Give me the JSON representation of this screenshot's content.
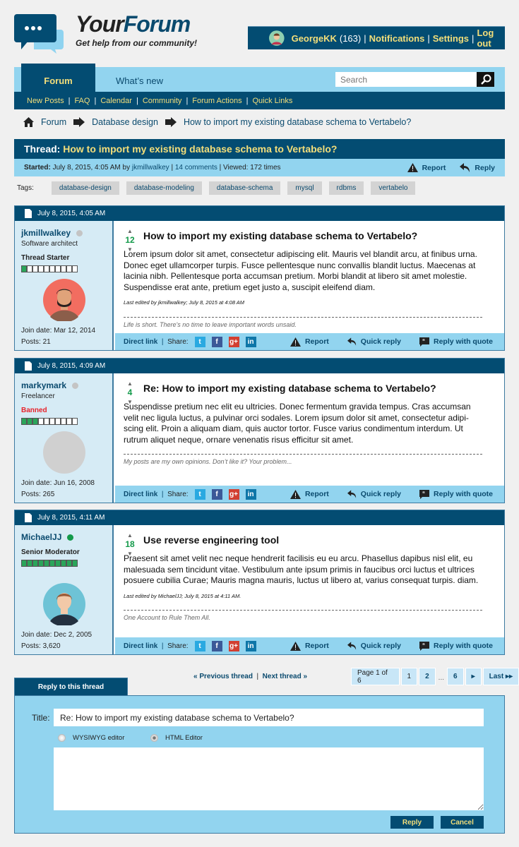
{
  "brand": {
    "name_a": "Your",
    "name_b": "Forum",
    "tagline": "Get help from our community!"
  },
  "user": {
    "name": "GeorgeKK",
    "points": "(163)",
    "notifications": "Notifications",
    "settings": "Settings",
    "logout": "Log out"
  },
  "nav": {
    "tabs": [
      "Forum",
      "What’s new"
    ],
    "search_placeholder": "Search",
    "sub": [
      "New Posts",
      "FAQ",
      "Calendar",
      "Community",
      "Forum Actions",
      "Quick Links"
    ]
  },
  "breadcrumb": [
    "Forum",
    "Database design",
    "How to import my existing database schema to Vertabelo?"
  ],
  "thread": {
    "prefix": "Thread:",
    "title": "How to import my existing database schema to Vertabelo?",
    "started_label": "Started:",
    "started": "July 8, 2015, 4:05 AM by",
    "author": "jkmillwalkey",
    "comments": "14 comments",
    "viewed": "Viewed: 172 times",
    "report": "Report",
    "reply": "Reply"
  },
  "tags_label": "Tags:",
  "tags": [
    "database-design",
    "database-modeling",
    "database-schema",
    "mysql",
    "rdbms",
    "vertabelo"
  ],
  "post_footer": {
    "direct_link": "Direct link",
    "share": "Share:",
    "report": "Report",
    "quick_reply": "Quick reply",
    "reply_quote": "Reply with quote"
  },
  "colors": {
    "dark": "#034c72",
    "light": "#92d4ef",
    "accent": "#f3de7a",
    "online": "#139a4a",
    "offline": "#c4c4c4",
    "banned": "#e8222a"
  },
  "posts": [
    {
      "date": "July 8, 2015, 4:05 AM",
      "user": "jkmillwalkey",
      "online": false,
      "role": "Software architect",
      "status": "Thread Starter",
      "status_color": "#222",
      "rank_filled": 1,
      "avatar": "bearded-man",
      "join": "Join date: Mar 12, 2014",
      "posts": "Posts: 21",
      "votes": "12",
      "title": "How to import my existing database schema to Vertabelo?",
      "text": "Lorem ipsum dolor sit amet, consectetur adipiscing elit. Mauris vel blandit arcu, at finibus urna. Donec eget ullamcorper turpis. Fusce pellentesque nunc convallis blandit luctus. Maecenas at lacinia nibh. Pellentesque porta accumsan pretium. Morbi blandit at libero sit amet molestie. Suspendisse erat ante, pretium eget justo a, suscipit eleifend diam.",
      "edited": "Last edited by jkmillwalkey; July 8, 2015 at 4:08 AM",
      "signature": "Life is short. There's no time to leave important words unsaid."
    },
    {
      "date": "July 8, 2015, 4:09 AM",
      "user": "markymark",
      "online": false,
      "role": "Freelancer",
      "status": "Banned",
      "status_color": "#e8222a",
      "rank_filled": 3,
      "avatar": "placeholder",
      "join": "Join date: Jun 16, 2008",
      "posts": "Posts: 265",
      "votes": "4",
      "title": "Re: How to import my existing database schema to Vertabelo?",
      "text": "Suspendisse pretium nec elit eu ultricies. Donec fermentum gravida tempus. Cras accumsan velit nec ligula luctus, a pulvinar orci sodales. Lorem ipsum dolor sit amet, consectetur adipi-scing elit. Proin a aliquam diam, quis auctor tortor. Fusce varius condimentum interdum. Ut rutrum aliquet neque, ornare venenatis risus efficitur sit amet.",
      "edited": "",
      "signature": "My posts are my own opinions. Don’t like it? Your problem..."
    },
    {
      "date": "July 8, 2015, 4:11 AM",
      "user": "MichaelJJ",
      "online": true,
      "role": "",
      "status": "Senior Moderator",
      "status_color": "#222",
      "rank_filled": 10,
      "avatar": "man",
      "join": "Join date: Dec 2, 2005",
      "posts": "Posts: 3,620",
      "votes": "18",
      "title": "Use reverse engineering tool",
      "text": "Praesent sit amet velit nec neque hendrerit facilisis eu eu arcu. Phasellus dapibus nisl elit, eu malesuada sem tincidunt vitae. Vestibulum ante ipsum primis in faucibus orci luctus et ultrices posuere cubilia Curae; Mauris magna mauris, luctus ut libero at, varius consequat turpis. diam.",
      "edited": "Last edited by MichaelJJ; July 8, 2015 at 4:11 AM.",
      "signature": "One Account to Rule Them All."
    }
  ],
  "pagination": {
    "prev": "« Previous thread",
    "next": "Next thread »",
    "page_of": "Page 1 of 6",
    "pages": [
      "1",
      "2",
      "...",
      "6"
    ],
    "last": "Last"
  },
  "reply_form": {
    "tab": "Reply to this thread",
    "title_label": "Title:",
    "title_value": "Re: How to import my existing database schema to Vertabelo?",
    "editor_options": [
      "WYSIWYG editor",
      "HTML Editor"
    ],
    "selected_editor": "HTML Editor",
    "reply": "Reply",
    "cancel": "Cancel"
  }
}
